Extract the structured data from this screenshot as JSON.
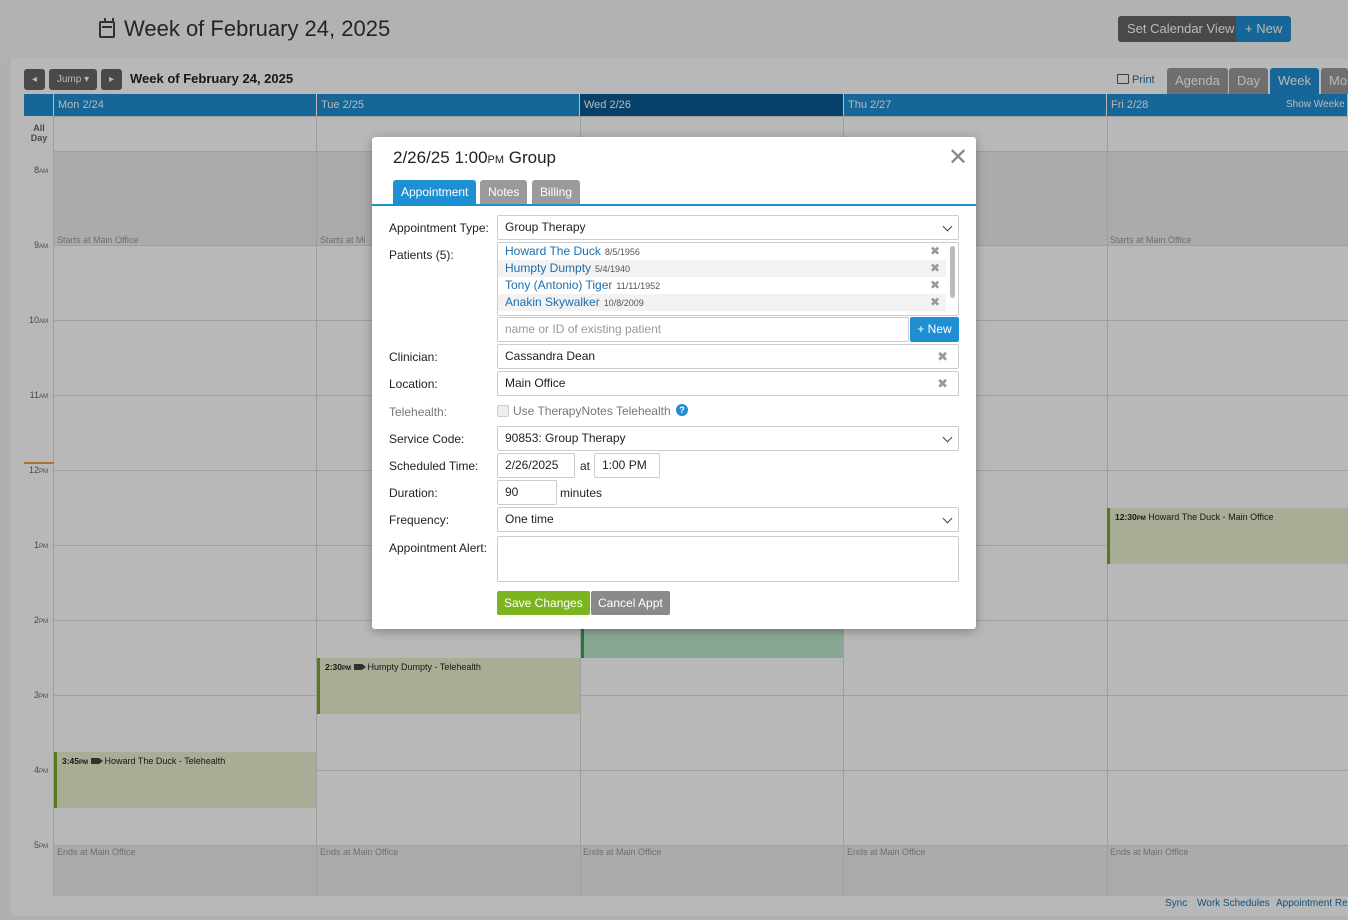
{
  "header": {
    "title": "Week of February 24, 2025",
    "set_view_label": "Set Calendar View",
    "new_label": "+ New"
  },
  "toolbar": {
    "prev_glyph": "◂",
    "jump_label": "Jump ▾",
    "next_glyph": "▸",
    "week_title": "Week of February 24, 2025",
    "print_label": "Print",
    "views": [
      "Agenda",
      "Day",
      "Week",
      "Mo"
    ],
    "active_view": "Week"
  },
  "calendar": {
    "days": [
      "Mon 2/24",
      "Tue 2/25",
      "Wed 2/26",
      "Thu 2/27",
      "Fri 2/28"
    ],
    "show_weekends": "Show Weeke",
    "allday_label": "All Day",
    "hours": [
      {
        "h": "8",
        "ampm": "AM"
      },
      {
        "h": "9",
        "ampm": "AM"
      },
      {
        "h": "10",
        "ampm": "AM"
      },
      {
        "h": "11",
        "ampm": "AM"
      },
      {
        "h": "12",
        "ampm": "PM"
      },
      {
        "h": "1",
        "ampm": "PM"
      },
      {
        "h": "2",
        "ampm": "PM"
      },
      {
        "h": "3",
        "ampm": "PM"
      },
      {
        "h": "4",
        "ampm": "PM"
      },
      {
        "h": "5",
        "ampm": "PM"
      }
    ],
    "starts_text": "Starts at Main Office",
    "starts_text_short": "Starts at Mi",
    "ends_text": "Ends at Main Office",
    "events": [
      {
        "time": "12:30",
        "ampm": "PM",
        "text": "Howard The Duck - Main Office"
      },
      {
        "time": "2:30",
        "ampm": "PM",
        "text": "Humpty Dumpty - Telehealth"
      },
      {
        "time": "3:45",
        "ampm": "PM",
        "text": "Howard The Duck - Telehealth"
      }
    ]
  },
  "footer": {
    "links": [
      "Sync",
      "Work Schedules",
      "Appointment Req"
    ]
  },
  "modal": {
    "title_date": "2/26/25 1:00",
    "title_ampm": "PM",
    "title_type": "Group",
    "close_glyph": "✕",
    "tabs": [
      "Appointment",
      "Notes",
      "Billing"
    ],
    "active_tab": "Appointment",
    "labels": {
      "appointment_type": "Appointment Type:",
      "patients": "Patients (5):",
      "clinician": "Clinician:",
      "location": "Location:",
      "telehealth": "Telehealth:",
      "service_code": "Service Code:",
      "scheduled_time": "Scheduled Time:",
      "duration": "Duration:",
      "frequency": "Frequency:",
      "alert": "Appointment Alert:"
    },
    "appointment_type": "Group Therapy",
    "patients": [
      {
        "name": "Howard The Duck",
        "dob": "8/5/1956"
      },
      {
        "name": "Humpty Dumpty",
        "dob": "5/4/1940"
      },
      {
        "name": "Tony (Antonio) Tiger",
        "dob": "11/11/1952"
      },
      {
        "name": "Anakin Skywalker",
        "dob": "10/8/2009"
      }
    ],
    "patient_search_placeholder": "name or ID of existing patient",
    "new_patient_label": "+ New",
    "clinician": "Cassandra Dean",
    "location": "Main Office",
    "telehealth_label": "Use TherapyNotes Telehealth",
    "telehealth_checked": false,
    "help_glyph": "?",
    "service_code": "90853: Group Therapy",
    "scheduled_date": "2/26/2025",
    "at_label": "at",
    "scheduled_time": "1:00 PM",
    "duration": "90",
    "duration_unit": "minutes",
    "frequency": "One time",
    "alert": "",
    "save_label": "Save Changes",
    "cancel_label": "Cancel Appt",
    "clear_glyph": "✖"
  },
  "colors": {
    "accent": "#1f8fd3",
    "accent_dark": "#0a5a92",
    "save": "#7cb51f",
    "event_bg": "#e8f2cf",
    "event_border": "#7aa82a"
  }
}
